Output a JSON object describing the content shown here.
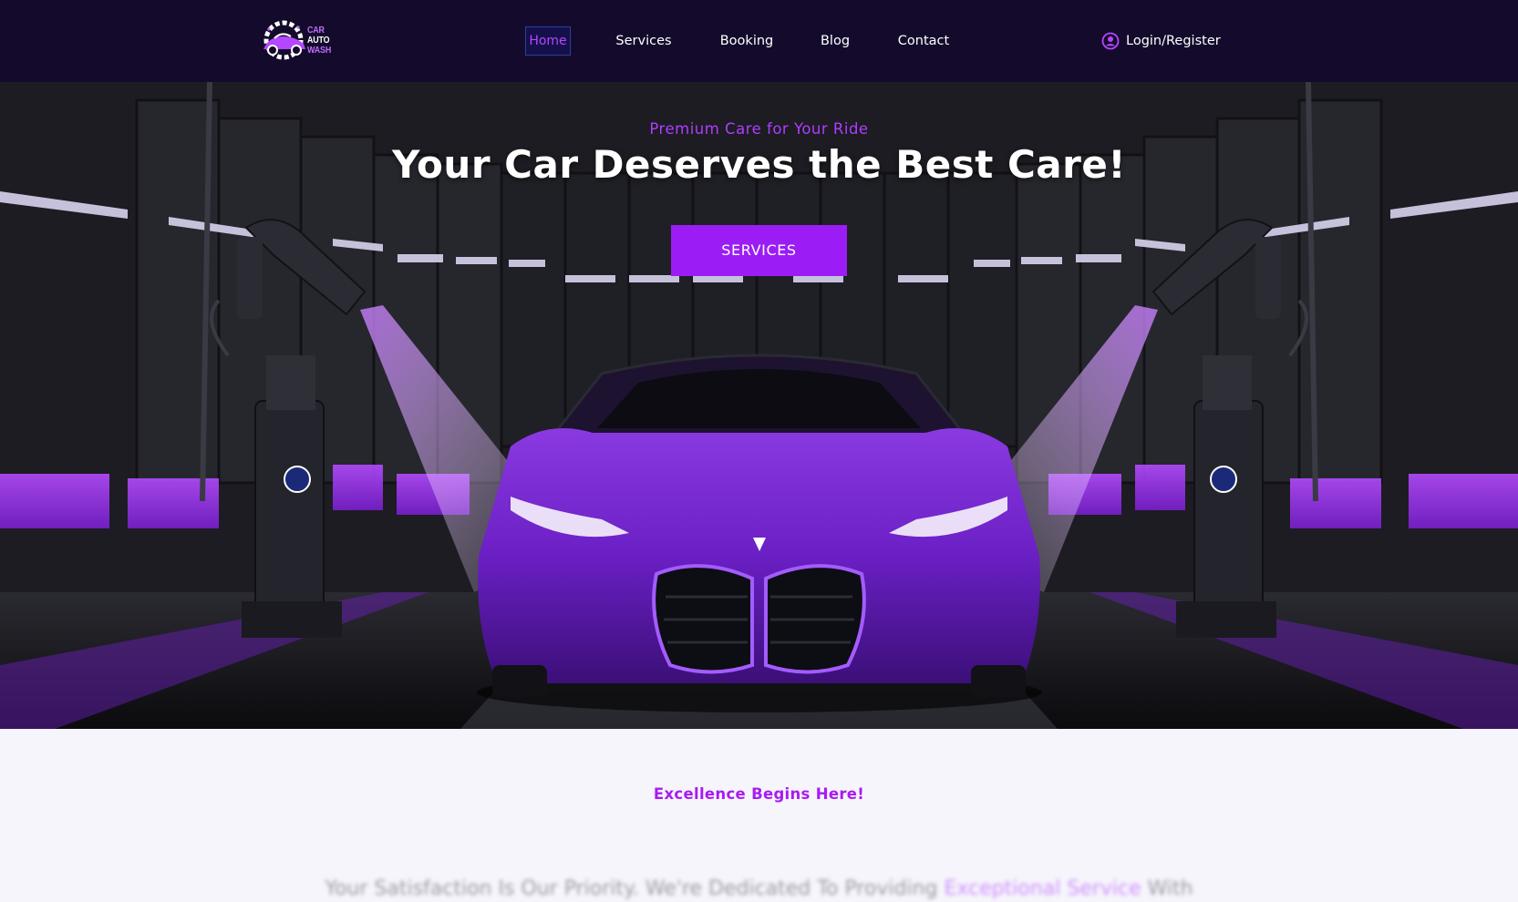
{
  "header": {
    "logo": {
      "line1": "CAR",
      "line2": "AUTO",
      "line3": "WASH"
    },
    "nav": [
      {
        "label": "Home",
        "active": true
      },
      {
        "label": "Services"
      },
      {
        "label": "Booking"
      },
      {
        "label": "Blog"
      },
      {
        "label": "Contact"
      }
    ],
    "login_label": "Login/Register",
    "login_icon": "user-circle-icon"
  },
  "hero": {
    "eyebrow": "Premium Care for Your Ride",
    "title": "Your Car Deserves the Best Care!",
    "button_label": "SERVICES"
  },
  "section": {
    "kicker": "Excellence Begins Here!",
    "intro_before": "Your Satisfaction Is Our Priority. We're Dedicated To Providing ",
    "intro_highlight": "Exceptional Service",
    "intro_after": " With"
  },
  "colors": {
    "header_bg": "#140b2c",
    "accent": "#9c1cf5",
    "accent_text": "#b13cff",
    "page_bg": "#f6f5fb"
  }
}
